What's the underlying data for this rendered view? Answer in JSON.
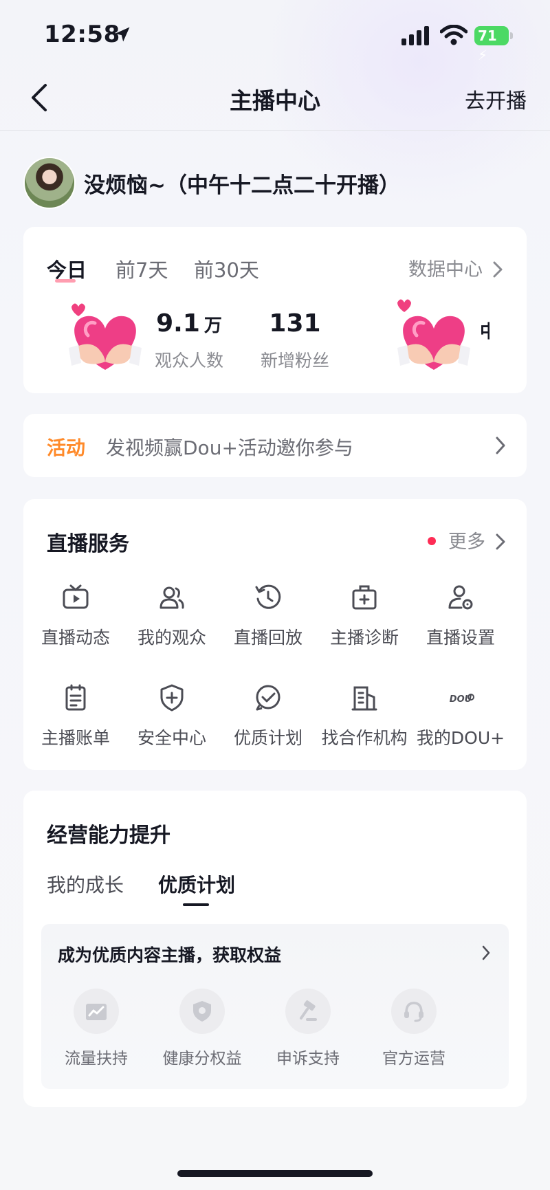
{
  "status_bar": {
    "time": "12:58",
    "battery": "71"
  },
  "nav": {
    "title": "主播中心",
    "go_live": "去开播"
  },
  "profile": {
    "name": "没烦恼~（中午十二点二十开播）"
  },
  "data_panel": {
    "tabs": [
      "今日",
      "前7天",
      "前30天"
    ],
    "active_tab": 0,
    "data_center": "数据中心",
    "stats": [
      {
        "value": "9.1",
        "unit": "万",
        "label": "观众人数"
      },
      {
        "value": "131",
        "unit": "",
        "label": "新增粉丝"
      }
    ],
    "clipped_glyph": "中"
  },
  "activity": {
    "tag": "活动",
    "text": "发视频赢Dou+活动邀你参与"
  },
  "live_service": {
    "title": "直播服务",
    "more": "更多",
    "items": [
      {
        "label": "直播动态",
        "icon": "tv-play-icon"
      },
      {
        "label": "我的观众",
        "icon": "users-icon"
      },
      {
        "label": "直播回放",
        "icon": "replay-clock-icon"
      },
      {
        "label": "主播诊断",
        "icon": "medical-kit-icon"
      },
      {
        "label": "直播设置",
        "icon": "user-settings-icon"
      },
      {
        "label": "主播账单",
        "icon": "bill-icon"
      },
      {
        "label": "安全中心",
        "icon": "shield-plus-icon"
      },
      {
        "label": "优质计划",
        "icon": "check-circle-icon"
      },
      {
        "label": "找合作机构",
        "icon": "building-icon"
      },
      {
        "label": "我的DOU+",
        "icon": "dou-plus-icon"
      }
    ]
  },
  "growth": {
    "title": "经营能力提升",
    "tabs": [
      "我的成长",
      "优质计划"
    ],
    "active_tab": 1,
    "banner": "成为优质内容主播，获取权益",
    "benefits": [
      {
        "label": "流量扶持",
        "icon": "traffic-chart-icon"
      },
      {
        "label": "健康分权益",
        "icon": "shield-icon"
      },
      {
        "label": "申诉支持",
        "icon": "gavel-icon"
      },
      {
        "label": "官方运营",
        "icon": "headset-icon"
      }
    ]
  },
  "colors": {
    "accent_pink": "#fe2c55",
    "activity_orange": "#ff8a2a",
    "battery_green": "#4cd964"
  }
}
